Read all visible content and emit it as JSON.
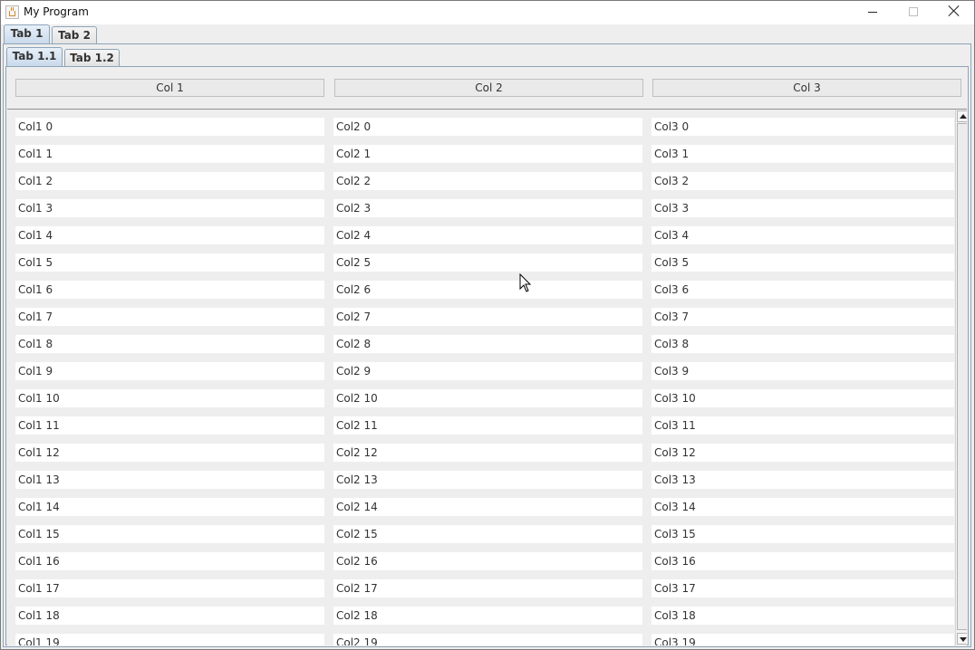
{
  "window": {
    "title": "My Program"
  },
  "outer_tabs": [
    {
      "label": "Tab 1",
      "selected": true
    },
    {
      "label": "Tab 2",
      "selected": false
    }
  ],
  "inner_tabs": [
    {
      "label": "Tab 1.1",
      "selected": true
    },
    {
      "label": "Tab 1.2",
      "selected": false
    }
  ],
  "columns": [
    "Col 1",
    "Col 2",
    "Col 3"
  ],
  "rows": [
    [
      "Col1 0",
      "Col2 0",
      "Col3 0"
    ],
    [
      "Col1 1",
      "Col2 1",
      "Col3 1"
    ],
    [
      "Col1 2",
      "Col2 2",
      "Col3 2"
    ],
    [
      "Col1 3",
      "Col2 3",
      "Col3 3"
    ],
    [
      "Col1 4",
      "Col2 4",
      "Col3 4"
    ],
    [
      "Col1 5",
      "Col2 5",
      "Col3 5"
    ],
    [
      "Col1 6",
      "Col2 6",
      "Col3 6"
    ],
    [
      "Col1 7",
      "Col2 7",
      "Col3 7"
    ],
    [
      "Col1 8",
      "Col2 8",
      "Col3 8"
    ],
    [
      "Col1 9",
      "Col2 9",
      "Col3 9"
    ],
    [
      "Col1 10",
      "Col2 10",
      "Col3 10"
    ],
    [
      "Col1 11",
      "Col2 11",
      "Col3 11"
    ],
    [
      "Col1 12",
      "Col2 12",
      "Col3 12"
    ],
    [
      "Col1 13",
      "Col2 13",
      "Col3 13"
    ],
    [
      "Col1 14",
      "Col2 14",
      "Col3 14"
    ],
    [
      "Col1 15",
      "Col2 15",
      "Col3 15"
    ],
    [
      "Col1 16",
      "Col2 16",
      "Col3 16"
    ],
    [
      "Col1 17",
      "Col2 17",
      "Col3 17"
    ],
    [
      "Col1 18",
      "Col2 18",
      "Col3 18"
    ],
    [
      "Col1 19",
      "Col2 19",
      "Col3 19"
    ]
  ],
  "icons": {
    "app": "java-cup-icon",
    "minimize": "minimize-icon",
    "maximize": "maximize-icon",
    "close": "close-icon"
  }
}
